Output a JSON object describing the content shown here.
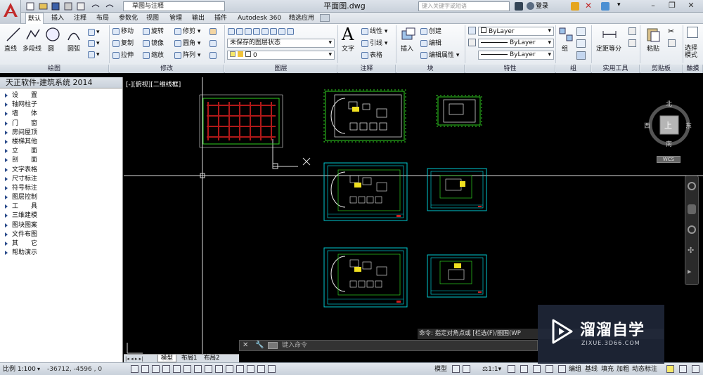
{
  "title_bar": {
    "workspace": "草图与注释",
    "document_title": "平面图.dwg",
    "search_placeholder": "键入关键字或短语",
    "login": "登录"
  },
  "menu_tabs": [
    "默认",
    "插入",
    "注释",
    "布局",
    "参数化",
    "视图",
    "管理",
    "输出",
    "插件",
    "Autodesk 360",
    "精选应用"
  ],
  "ribbon": {
    "draw": {
      "line": "直线",
      "polyline": "多段线",
      "circle": "圆",
      "arc": "圆弧",
      "label": "绘图"
    },
    "modify": {
      "move": "移动",
      "rotate": "旋转",
      "trim": "修剪",
      "copy": "复制",
      "mirror": "镜像",
      "fillet": "圆角",
      "stretch": "拉伸",
      "scale": "缩放",
      "array": "阵列",
      "label": "修改"
    },
    "layers": {
      "state": "未保存的图层状态",
      "current": "0",
      "label": "图层"
    },
    "annotation": {
      "text": "文字",
      "linear": "线性",
      "leader": "引线",
      "table": "表格",
      "label": "注释"
    },
    "block": {
      "insert": "插入",
      "create": "创建",
      "edit": "编辑",
      "edit_attributes": "编辑属性",
      "label": "块"
    },
    "properties": {
      "color": "ByLayer",
      "linetype": "ByLayer",
      "lineweight": "ByLayer",
      "label": "特性"
    },
    "groups": {
      "group": "组",
      "label": "组"
    },
    "utilities": {
      "measure": "定距等分",
      "label": "实用工具"
    },
    "clipboard": {
      "paste": "粘贴",
      "label": "剪贴板"
    },
    "touch": {
      "select_mode": "选择模式",
      "label": "触摸"
    }
  },
  "sidebar": {
    "title": "天正软件-建筑系统 2014",
    "items": [
      "设　　置",
      "轴网柱子",
      "墙　　体",
      "门　　窗",
      "房间屋顶",
      "楼梯其他",
      "立　　面",
      "剖　　面",
      "文字表格",
      "尺寸标注",
      "符号标注",
      "图层控制",
      "工　　具",
      "三维建模",
      "图块图案",
      "文件布图",
      "其　　它",
      "帮助演示"
    ]
  },
  "viewport": {
    "label": "[-][俯视][二维线框]",
    "compass": {
      "north": "北",
      "south": "南",
      "east": "东",
      "west": "西",
      "top": "上",
      "ucs": "WCS"
    }
  },
  "command": {
    "history": "命令: 指定对角点或 [栏选(F)/圈围(WP",
    "placeholder": "键入命令"
  },
  "layout_tabs": [
    "模型",
    "布局1",
    "布局2"
  ],
  "status_bar": {
    "scale": "比例 1:100",
    "coords": "-36712, -4596 , 0",
    "model": "模型",
    "annotation_scale": "1:1",
    "items": [
      "编组",
      "基线",
      "填充",
      "加粗",
      "动态标注"
    ]
  },
  "watermark": {
    "name": "溜溜自学",
    "url": "ZIXUE.3D66.COM"
  },
  "colors": {
    "canvas": "#000000",
    "accent": "#c22a2a",
    "cyan": "#00c8d0",
    "green": "#30d020",
    "red_hatch": "#b01818"
  }
}
